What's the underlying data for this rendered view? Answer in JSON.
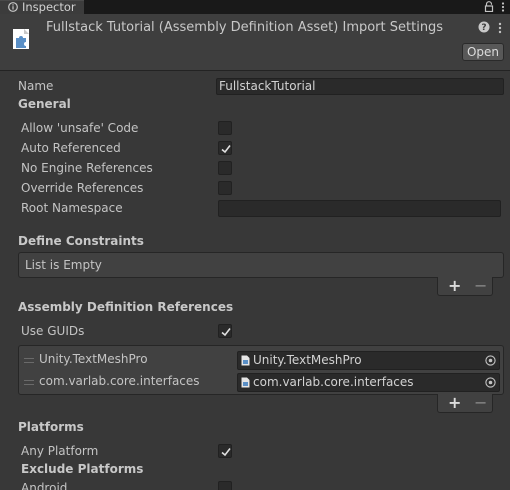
{
  "tab": {
    "label": "Inspector"
  },
  "header": {
    "title": "Fullstack Tutorial (Assembly Definition Asset) Import Settings",
    "open_label": "Open"
  },
  "name_field": {
    "label": "Name",
    "value": "FullstackTutorial"
  },
  "general": {
    "heading": "General",
    "allow_unsafe": {
      "label": "Allow 'unsafe' Code",
      "checked": false
    },
    "auto_referenced": {
      "label": "Auto Referenced",
      "checked": true
    },
    "no_engine_references": {
      "label": "No Engine References",
      "checked": false
    },
    "override_references": {
      "label": "Override References",
      "checked": false
    },
    "root_namespace": {
      "label": "Root Namespace",
      "value": ""
    }
  },
  "define_constraints": {
    "heading": "Define Constraints",
    "empty_text": "List is Empty",
    "add_label": "+",
    "remove_label": "−"
  },
  "assembly_references": {
    "heading": "Assembly Definition References",
    "use_guids": {
      "label": "Use GUIDs",
      "checked": true
    },
    "items": [
      {
        "label": "Unity.TextMeshPro",
        "value": "Unity.TextMeshPro"
      },
      {
        "label": "com.varlab.core.interfaces",
        "value": "com.varlab.core.interfaces"
      }
    ],
    "add_label": "+",
    "remove_label": "−"
  },
  "platforms": {
    "heading": "Platforms",
    "any_platform": {
      "label": "Any Platform",
      "checked": true
    },
    "exclude_heading": "Exclude Platforms",
    "android": {
      "label": "Android",
      "checked": false
    }
  },
  "icons": {
    "tab": "info-icon",
    "lock": "lock-icon",
    "menu": "kebab-menu-icon",
    "asset": "puzzle-icon",
    "help": "help-icon",
    "settings": "kebab-menu-icon",
    "check": "checkmark-icon",
    "asset_ref": "file-icon",
    "picker": "object-picker-icon",
    "drag": "drag-handle-icon"
  },
  "colors": {
    "background": "#383838",
    "header": "#3e3e3e",
    "field": "#2a2a2a",
    "text": "#c4c4c4",
    "asset_icon_blue": "#5a8fc6"
  }
}
